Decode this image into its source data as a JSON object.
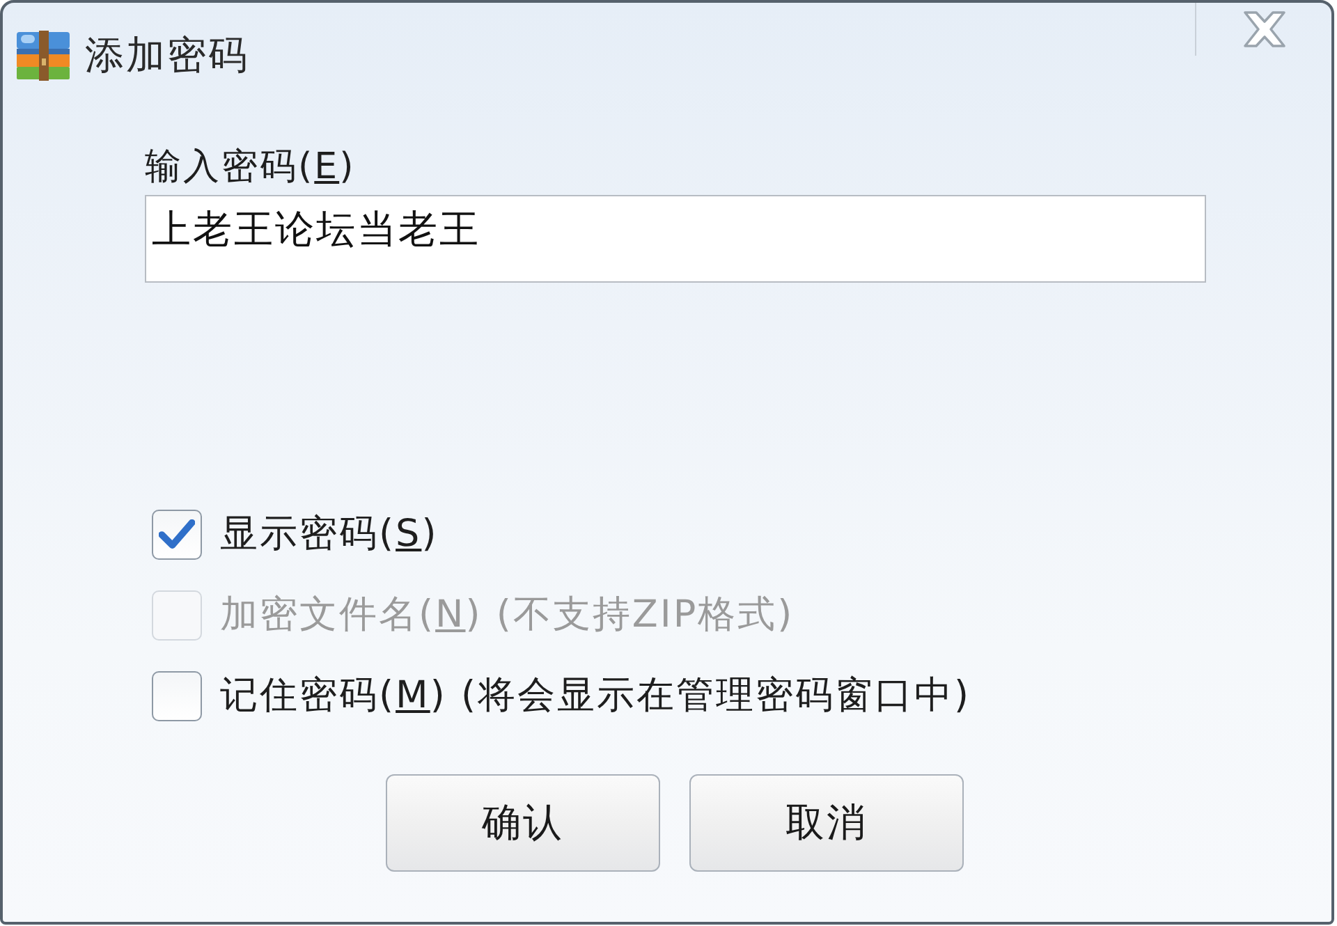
{
  "window": {
    "title": "添加密码"
  },
  "password": {
    "label_before": "输入密码(",
    "hotkey": "E",
    "label_after": ")",
    "value": "上老王论坛当老王"
  },
  "options": [
    {
      "label_before": "显示密码(",
      "hotkey": "S",
      "label_after": ")",
      "checked": true,
      "disabled": false
    },
    {
      "label_before": "加密文件名(",
      "hotkey": "N",
      "label_after": ") (不支持ZIP格式)",
      "checked": false,
      "disabled": true
    },
    {
      "label_before": "记住密码(",
      "hotkey": "M",
      "label_after": ") (将会显示在管理密码窗口中)",
      "checked": false,
      "disabled": false
    }
  ],
  "buttons": [
    {
      "label": "确认"
    },
    {
      "label": "取消"
    }
  ]
}
